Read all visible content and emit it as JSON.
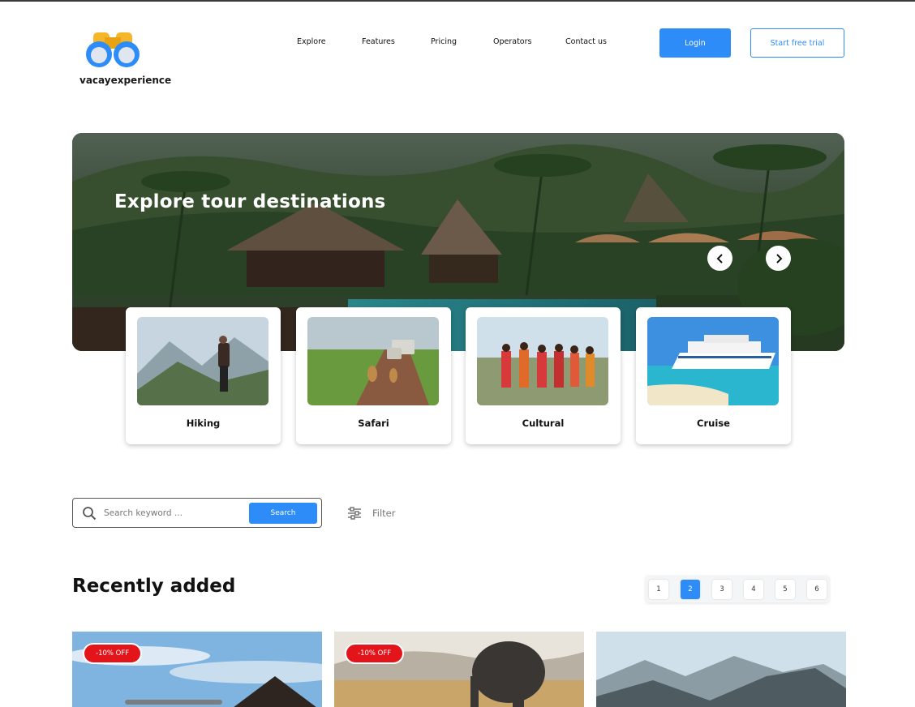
{
  "header": {
    "logo_text": "vacayexperience",
    "nav": [
      "Explore",
      "Features",
      "Pricing",
      "Operators",
      "Contact us"
    ],
    "login_label": "Login",
    "trial_label": "Start free trial",
    "brand_blue": "#2e8cf8",
    "logo_colors": [
      "#f5b62a",
      "#2e8cf8"
    ]
  },
  "hero": {
    "title": "Explore tour destinations",
    "prev_icon": "chevron-left-icon",
    "next_icon": "chevron-right-icon"
  },
  "categories": [
    {
      "label": "Hiking"
    },
    {
      "label": "Safari"
    },
    {
      "label": "Cultural"
    },
    {
      "label": "Cruise"
    }
  ],
  "search": {
    "placeholder": "Search keyword ...",
    "button_label": "Search",
    "filter_label": "Filter"
  },
  "recent": {
    "title": "Recently added",
    "pages": [
      "1",
      "2",
      "3",
      "4",
      "5",
      "6"
    ],
    "active_page": "2",
    "cards": [
      {
        "badge": "-10% OFF"
      },
      {
        "badge": "-10% OFF"
      },
      {
        "badge": ""
      }
    ],
    "badge_color": "#e4141b"
  }
}
